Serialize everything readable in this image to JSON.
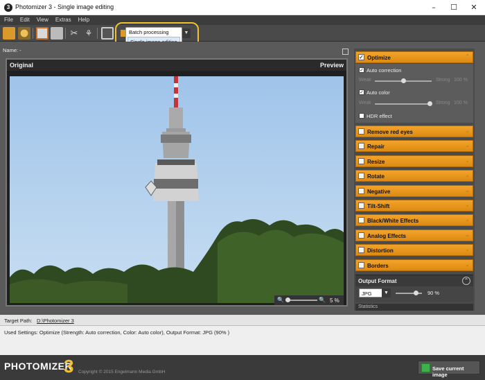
{
  "window": {
    "title": "Photomizer 3 - Single image editing",
    "minimize": "–",
    "maximize": "☐",
    "close": "✕"
  },
  "menu": [
    "File",
    "Edit",
    "View",
    "Extras",
    "Help"
  ],
  "mode_dropdown": {
    "options": [
      "Batch processing",
      "Single image editing"
    ],
    "selected": "Single image editing"
  },
  "name_bar": {
    "label": "Name: -"
  },
  "image_panel": {
    "original_label": "Original",
    "preview_label": "Preview",
    "zoom_percent": "5 %"
  },
  "optimize": {
    "title": "Optimize",
    "auto_correction": {
      "label": "Auto correction",
      "checked": true,
      "weak": "Weak",
      "strong": "Strong",
      "value": "100 %"
    },
    "auto_color": {
      "label": "Auto color",
      "checked": true,
      "weak": "Weak",
      "strong": "Strong",
      "value": "100 %"
    },
    "hdr": {
      "label": "HDR effect",
      "checked": false
    }
  },
  "sections": [
    "Remove red eyes",
    "Repair",
    "Resize",
    "Rotate",
    "Negative",
    "Tilt-Shift",
    "Black/White Effects",
    "Analog Effects",
    "Distortion",
    "Borders"
  ],
  "output": {
    "title": "Output Format",
    "format": "JPG",
    "quality": "90 %",
    "next_section": "Statistics"
  },
  "target": {
    "label": "Target Path:",
    "value": "D:\\Photomizer 3"
  },
  "used_settings": "Used Settings: Optimize (Strength: Auto correction, Color: Auto color), Output Format: JPG (90% )",
  "footer": {
    "logo": "PHOTOMIZER",
    "logo_number": "3",
    "copyright": "Copyright © 2015 Engelmann Media GmbH",
    "save_label": "Save current image"
  }
}
